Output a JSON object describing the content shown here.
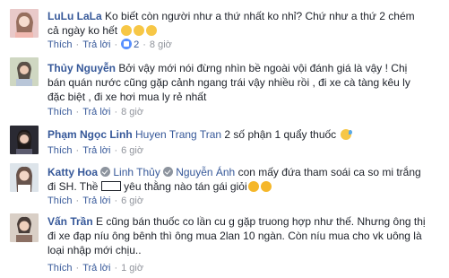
{
  "comments": [
    {
      "name": "LuLu LaLa",
      "segments": [
        "Ko biết còn người như a thứ nhất ko nhỉ? Chứ như a thứ 2 chém",
        "cả ngày ko hết"
      ],
      "like_label": "Thích",
      "reply_label": "Trả lời",
      "like_count": "2",
      "time": "8 giờ"
    },
    {
      "name": "Thủy Nguyễn",
      "line1": "Bởi vậy mới nói đừng nhìn bề ngoài vội đánh giá là vậy ! Chị",
      "line2": "bán quán nước cũng gặp cảnh ngang trái vậy nhiều rồi , đi xe cà tàng kêu ly",
      "line3": "đặc biệt , đi xe hơi mua ly rẻ nhất",
      "like_label": "Thích",
      "reply_label": "Trả lời",
      "time": "8 giờ"
    },
    {
      "name": "Phạm Ngọc Linh",
      "tag": "Huyen Trang Tran",
      "text": "2 số phận 1 quẩy thuốc",
      "like_label": "Thích",
      "reply_label": "Trả lời",
      "time": "6 giờ"
    },
    {
      "name": "Katty Hoa",
      "tag1": "Linh Thủy",
      "tag2": "Nguyễn Ánh",
      "text1": "con mấy đứa tham soái ca so mi trắng",
      "line2_a": "đi SH. Thề",
      "line2_b": "yêu thằng nào tán gái giỏi",
      "like_label": "Thích",
      "reply_label": "Trả lời",
      "time": "6 giờ"
    },
    {
      "name": "Vấn Trần",
      "line1": "E cũng bán thuốc co lần cu g gặp truong hợp như thế. Nhưng ông thị",
      "line2": "đi xe đạp níu ông bênh thì ông mua 2lan 10 ngàn. Còn níu mua cho vk uông là",
      "line3": "loại nhập mới chịu..",
      "like_label": "Thích",
      "reply_label": "Trả lời",
      "time": "1 giờ"
    }
  ],
  "icons": {
    "emoji_sad": "confounded-face-icon",
    "emoji_sweat": "downcast-sweat-face-icon",
    "emoji_laugh": "tears-of-joy-icon",
    "like": "like-thumb-icon"
  },
  "colors": {
    "name": "#365899",
    "meta": "#90949c",
    "text": "#1d2129"
  }
}
